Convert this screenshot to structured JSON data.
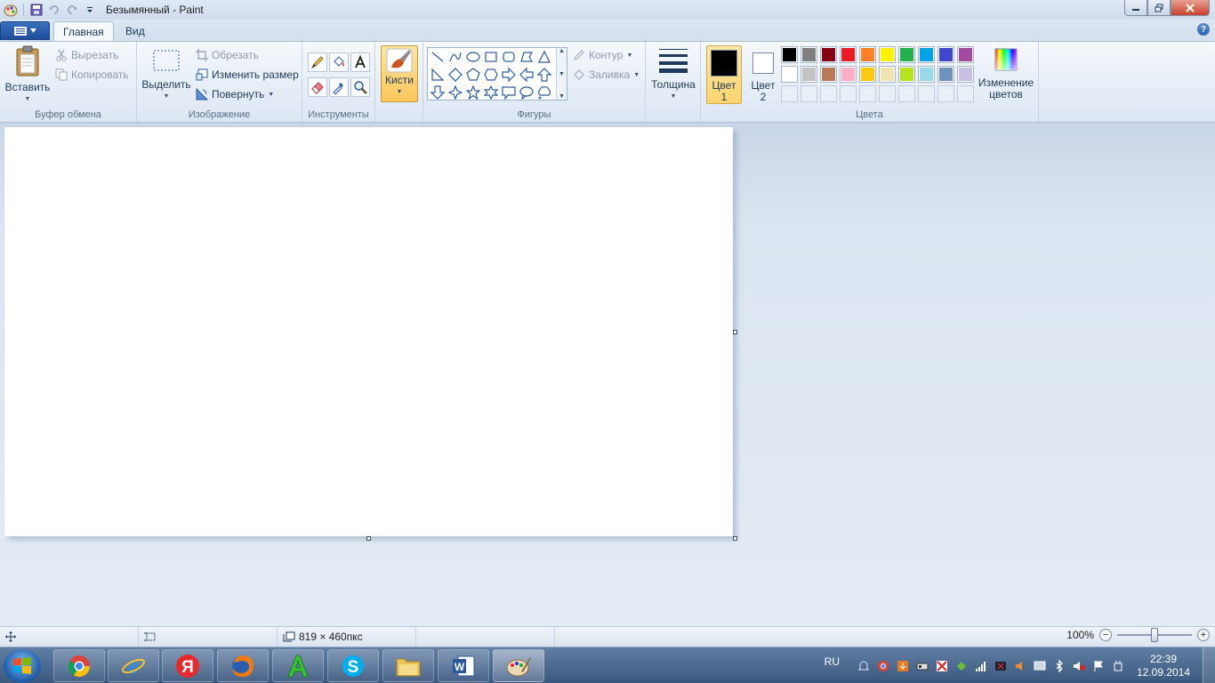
{
  "window": {
    "title": "Безымянный - Paint"
  },
  "tabs": [
    {
      "label": "Главная",
      "active": true
    },
    {
      "label": "Вид",
      "active": false
    }
  ],
  "clipboard": {
    "paste_label": "Вставить",
    "cut_label": "Вырезать",
    "copy_label": "Копировать",
    "group_label": "Буфер обмена"
  },
  "image": {
    "select_label": "Выделить",
    "crop_label": "Обрезать",
    "resize_label": "Изменить размер",
    "rotate_label": "Повернуть",
    "group_label": "Изображение"
  },
  "tools": {
    "group_label": "Инструменты"
  },
  "brushes": {
    "label": "Кисти"
  },
  "shapes": {
    "outline_label": "Контур",
    "fill_label": "Заливка",
    "group_label": "Фигуры"
  },
  "size": {
    "label": "Толщина"
  },
  "colors": {
    "color1_label": "Цвет 1",
    "color1_line1": "Цвет",
    "color1_line2": "1",
    "color2_line1": "Цвет",
    "color2_line2": "2",
    "edit_line1": "Изменение",
    "edit_line2": "цветов",
    "group_label": "Цвета",
    "color1_value": "#000000",
    "color2_value": "#ffffff",
    "palette_row1": [
      "#000000",
      "#7f7f7f",
      "#880015",
      "#ed1c24",
      "#ff7f27",
      "#fff200",
      "#22b14c",
      "#00a2e8",
      "#3f48cc",
      "#a349a4"
    ],
    "palette_row2": [
      "#ffffff",
      "#c3c3c3",
      "#b97a57",
      "#ffaec9",
      "#ffc90e",
      "#efe4b0",
      "#b5e61d",
      "#99d9ea",
      "#7092be",
      "#c8bfe7"
    ]
  },
  "status": {
    "canvas_size": "819 × 460пкс",
    "zoom": "100%"
  },
  "taskbar": {
    "language": "RU",
    "time": "22:39",
    "date": "12.09.2014",
    "apps": [
      "chrome-icon",
      "ie-icon",
      "yandex-icon",
      "firefox-icon",
      "a-icon",
      "skype-icon",
      "explorer-icon",
      "word-icon",
      "paint-icon"
    ]
  }
}
